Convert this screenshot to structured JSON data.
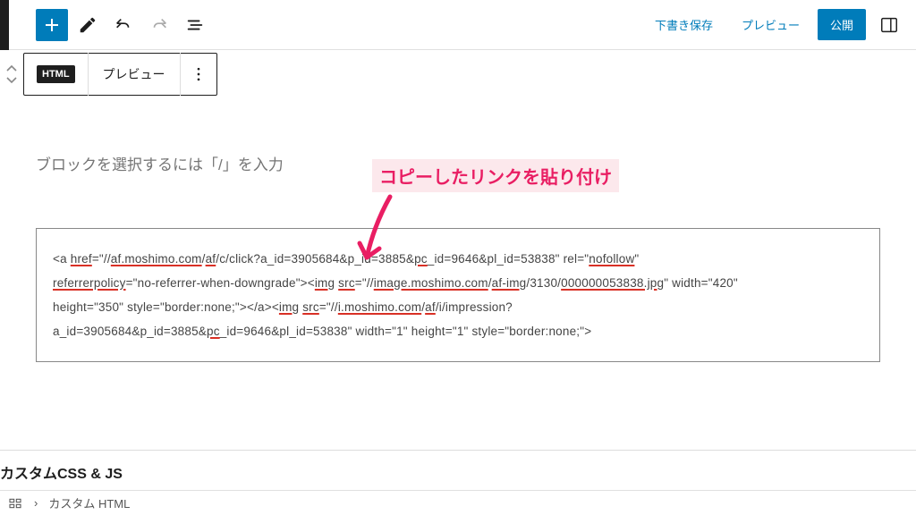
{
  "toolbar": {
    "draft_save": "下書き保存",
    "preview": "プレビュー",
    "publish": "公開"
  },
  "block_toolbar": {
    "html_label": "HTML",
    "preview_tab": "プレビュー"
  },
  "annotation": {
    "text": "コピーしたリンクを貼り付け"
  },
  "editor": {
    "placeholder": "ブロックを選択するには「/」を入力"
  },
  "code": {
    "line1_a": "<a ",
    "line1_href": "href",
    "line1_b": "=\"//",
    "line1_dom1": "af.moshimo.com",
    "line1_c": "/",
    "line1_af": "af",
    "line1_d": "/c/click?a_id=3905684&p_id=3885&",
    "line1_pc": "pc",
    "line1_e": "_id=9646&pl_id=53838\" rel=\"",
    "line1_nofollow": "nofollow",
    "line1_f": "\"",
    "line2_ref": "referrerpolicy",
    "line2_a": "=\"no-referrer-when-downgrade\"><",
    "line2_img": "img",
    "line2_sp": " ",
    "line2_src": "src",
    "line2_b": "=\"//",
    "line2_dom2": "image.moshimo.com",
    "line2_c": "/",
    "line2_afimg": "af-img",
    "line2_d": "/3130/",
    "line2_file": "000000053838.jpg",
    "line2_e": "\" width=\"420\"",
    "line3_a": "height=\"350\"  style=\"border:none;\"></a><",
    "line3_img": "img",
    "line3_sp": " ",
    "line3_src": "src",
    "line3_b": "=\"//",
    "line3_dom3": "i.moshimo.com",
    "line3_c": "/",
    "line3_af": "af",
    "line3_d": "/i/impression?",
    "line4_a": "a_id=3905684&p_id=3885&",
    "line4_pc": "pc",
    "line4_b": "_id=9646&pl_id=53838\" width=\"1\" height=\"1\" style=\"border:none;\">"
  },
  "footer": {
    "section": "カスタムCSS & JS",
    "bc_sep": "›",
    "bc_item": "カスタム HTML"
  }
}
